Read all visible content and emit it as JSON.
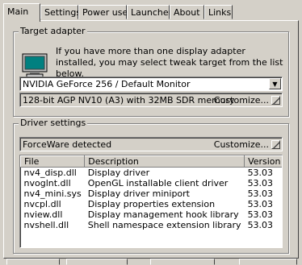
{
  "tabs": [
    "Main",
    "Settings",
    "Power user",
    "Launcher",
    "About",
    "Links"
  ],
  "target_adapter": {
    "title": "Target adapter",
    "description": "If you have more than one display adapter installed, you may select tweak target from the list below.",
    "adapter_selected": "NVIDIA GeForce 256 / Default Monitor",
    "adapter_info": "128-bit AGP NV10 (A3) with 32MB SDR memory",
    "customize_label": "Customize..."
  },
  "driver_settings": {
    "title": "Driver settings",
    "status": "ForceWare detected",
    "customize_label": "Customize...",
    "columns": [
      "File",
      "Description",
      "Version"
    ],
    "rows": [
      [
        "nv4_disp.dll",
        "Display driver",
        "53.03"
      ],
      [
        "nvoglnt.dll",
        "OpenGL installable client driver",
        "53.03"
      ],
      [
        "nv4_mini.sys",
        "Display driver miniport",
        "53.03"
      ],
      [
        "nvcpl.dll",
        "Display properties extension",
        "53.03"
      ],
      [
        "nview.dll",
        "Display management hook library",
        "53.03"
      ],
      [
        "nvshell.dll",
        "Shell namespace extension library",
        "53.03"
      ]
    ]
  }
}
